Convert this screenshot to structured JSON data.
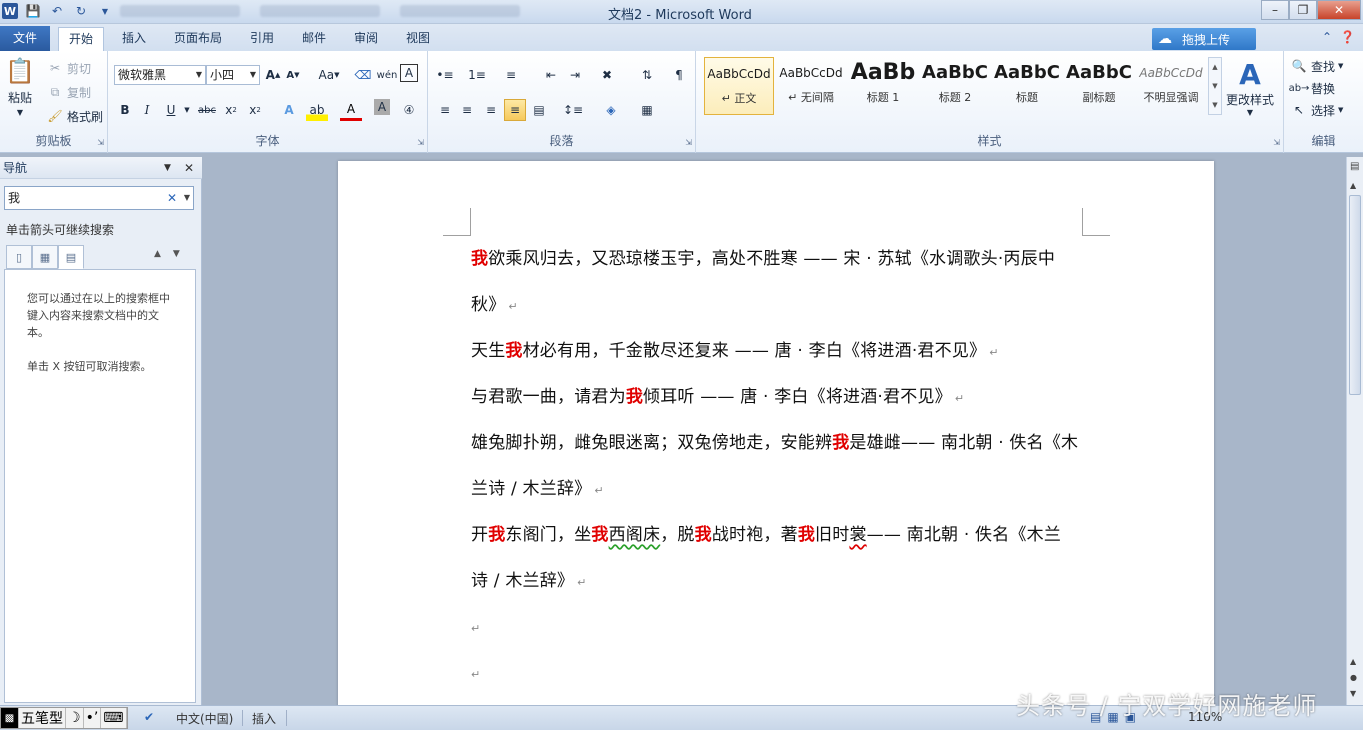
{
  "window": {
    "title": "文档2 - Microsoft Word"
  },
  "tabs": {
    "file": "文件",
    "home": "开始",
    "insert": "插入",
    "page_layout": "页面布局",
    "references": "引用",
    "mailings": "邮件",
    "review": "审阅",
    "view": "视图",
    "upload": "拖拽上传"
  },
  "clipboard": {
    "paste": "粘贴",
    "cut": "剪切",
    "copy": "复制",
    "format_painter": "格式刷",
    "label": "剪贴板"
  },
  "font": {
    "name": "微软雅黑",
    "size": "小四",
    "case": "Aa",
    "label": "字体"
  },
  "paragraph": {
    "label": "段落"
  },
  "styles": {
    "label": "样式",
    "items": [
      {
        "sample": "AaBbCcDd",
        "name": "↵ 正文"
      },
      {
        "sample": "AaBbCcDd",
        "name": "↵ 无间隔"
      },
      {
        "sample": "AaBb",
        "name": "标题 1"
      },
      {
        "sample": "AaBbC",
        "name": "标题 2"
      },
      {
        "sample": "AaBbC",
        "name": "标题"
      },
      {
        "sample": "AaBbC",
        "name": "副标题"
      },
      {
        "sample": "AaBbCcDd",
        "name": "不明显强调"
      }
    ],
    "change_styles": "更改样式"
  },
  "editing": {
    "find": "查找",
    "replace": "替换",
    "select": "选择",
    "label": "编辑"
  },
  "nav": {
    "title": "导航",
    "search_value": "我",
    "hint": "单击箭头可继续搜索",
    "msg1": "您可以通过在以上的搜索框中键入内容来搜索文档中的文本。",
    "msg2": "单击 X 按钮可取消搜索。"
  },
  "document": {
    "p1a_hl": "我",
    "p1a_rest": "欲乘风归去，又恐琼楼玉宇，高处不胜寒 —— 宋 · 苏轼《水调歌头·丙辰中",
    "p1b": "秋》",
    "p2_pre": "天生",
    "p2_hl": "我",
    "p2_post": "材必有用，千金散尽还复来 —— 唐 · 李白《将进酒·君不见》",
    "p3_pre": "与君歌一曲，请君为",
    "p3_hl": "我",
    "p3_post": "倾耳听 —— 唐 · 李白《将进酒·君不见》",
    "p4_pre": "雄兔脚扑朔，雌兔眼迷离；双兔傍地走，安能辨",
    "p4_hl": "我",
    "p4_post": "是雄雌—— 南北朝 · 佚名《木",
    "p4b": "兰诗 / 木兰辞》",
    "p5_a": "开",
    "p5_hl1": "我",
    "p5_b": "东阁门，坐",
    "p5_hl2": "我",
    "p5_c": "西阁床",
    "p5_d": "，脱",
    "p5_hl3": "我",
    "p5_e": "战时袍，著",
    "p5_hl4": "我",
    "p5_f": "旧时",
    "p5_g": "裳",
    "p5_h": "—— 南北朝 · 佚名《木兰",
    "p5b": "诗 / 木兰辞》",
    "mark": "↵"
  },
  "status": {
    "ime_name": "五笔型",
    "language": "中文(中国)",
    "mode": "插入",
    "zoom": "110%"
  },
  "watermark": "头条号 / 宁双学好网施老师"
}
